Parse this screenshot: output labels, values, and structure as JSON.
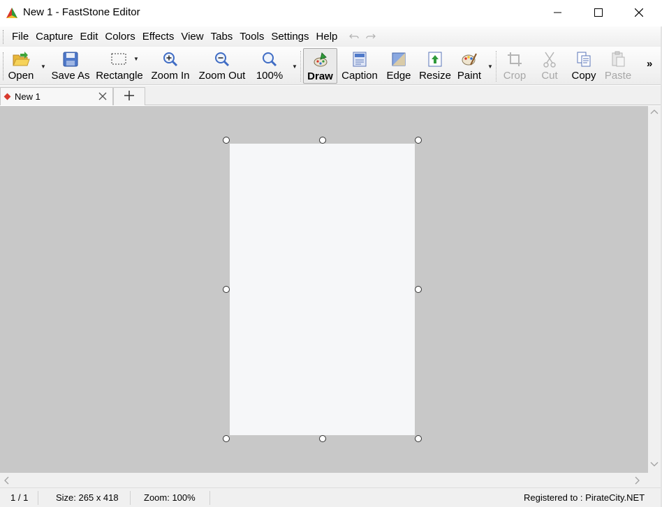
{
  "window": {
    "title": "New 1 - FastStone Editor",
    "controls": {
      "minimize": "minimize-icon",
      "maximize": "maximize-icon",
      "close": "close-icon"
    }
  },
  "menu": {
    "items": [
      "File",
      "Capture",
      "Edit",
      "Colors",
      "Effects",
      "View",
      "Tabs",
      "Tools",
      "Settings",
      "Help"
    ]
  },
  "toolbar": {
    "open": "Open",
    "save_as": "Save As",
    "rectangle": "Rectangle",
    "zoom_in": "Zoom In",
    "zoom_out": "Zoom Out",
    "zoom_level": "100%",
    "draw": "Draw",
    "caption": "Caption",
    "edge": "Edge",
    "resize": "Resize",
    "paint": "Paint",
    "crop": "Crop",
    "cut": "Cut",
    "copy": "Copy",
    "paste": "Paste",
    "more": "»"
  },
  "tabs": {
    "active_tab": "New 1",
    "new_tab_icon": "plus-icon"
  },
  "status": {
    "page": "1 / 1",
    "size": "Size: 265 x 418",
    "zoom": "Zoom: 100%",
    "registered": "Registered to : PirateCity.NET"
  },
  "colors": {
    "canvas": "#c8c8c8",
    "image": "#f6f7f9",
    "tab_marker": "#d83a2e"
  }
}
